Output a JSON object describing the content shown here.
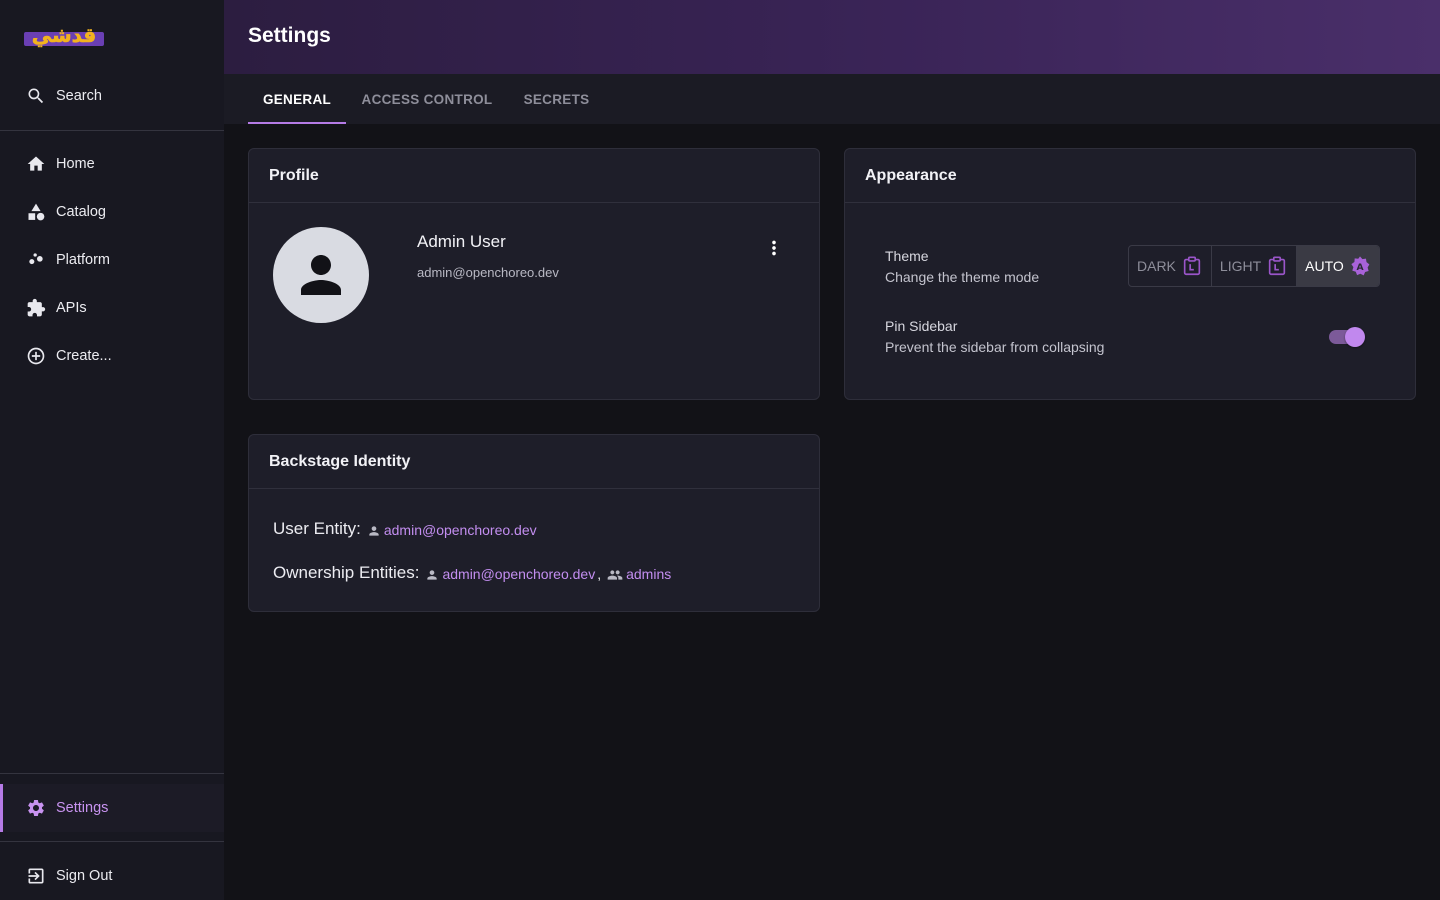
{
  "sidebar": {
    "logo_text": "قدشي",
    "search_label": "Search",
    "items": [
      {
        "label": "Home",
        "icon": "home-icon"
      },
      {
        "label": "Catalog",
        "icon": "catalog-icon"
      },
      {
        "label": "Platform",
        "icon": "platform-icon"
      },
      {
        "label": "APIs",
        "icon": "puzzle-icon"
      },
      {
        "label": "Create...",
        "icon": "add-circle-icon"
      }
    ],
    "settings_label": "Settings",
    "signout_label": "Sign Out"
  },
  "header": {
    "title": "Settings"
  },
  "tabs": [
    {
      "label": "GENERAL",
      "active": true
    },
    {
      "label": "ACCESS CONTROL",
      "active": false
    },
    {
      "label": "SECRETS",
      "active": false
    }
  ],
  "profile": {
    "title": "Profile",
    "name": "Admin User",
    "email": "admin@openchoreo.dev"
  },
  "appearance": {
    "title": "Appearance",
    "theme_title": "Theme",
    "theme_subtitle": "Change the theme mode",
    "theme_options": [
      {
        "label": "DARK",
        "active": false
      },
      {
        "label": "LIGHT",
        "active": false
      },
      {
        "label": "AUTO",
        "active": true
      }
    ],
    "pin_title": "Pin Sidebar",
    "pin_subtitle": "Prevent the sidebar from collapsing",
    "pin_enabled": true
  },
  "identity": {
    "title": "Backstage Identity",
    "user_entity_label": "User Entity:",
    "user_entity": "admin@openchoreo.dev",
    "ownership_label": "Ownership Entities:",
    "ownership_user": "admin@openchoreo.dev",
    "ownership_group": "admins",
    "separator": ","
  },
  "colors": {
    "accent": "#b57be6",
    "link": "#c38ef0",
    "background": "#121217",
    "sidebar": "#181821",
    "card": "#1e1e29"
  }
}
